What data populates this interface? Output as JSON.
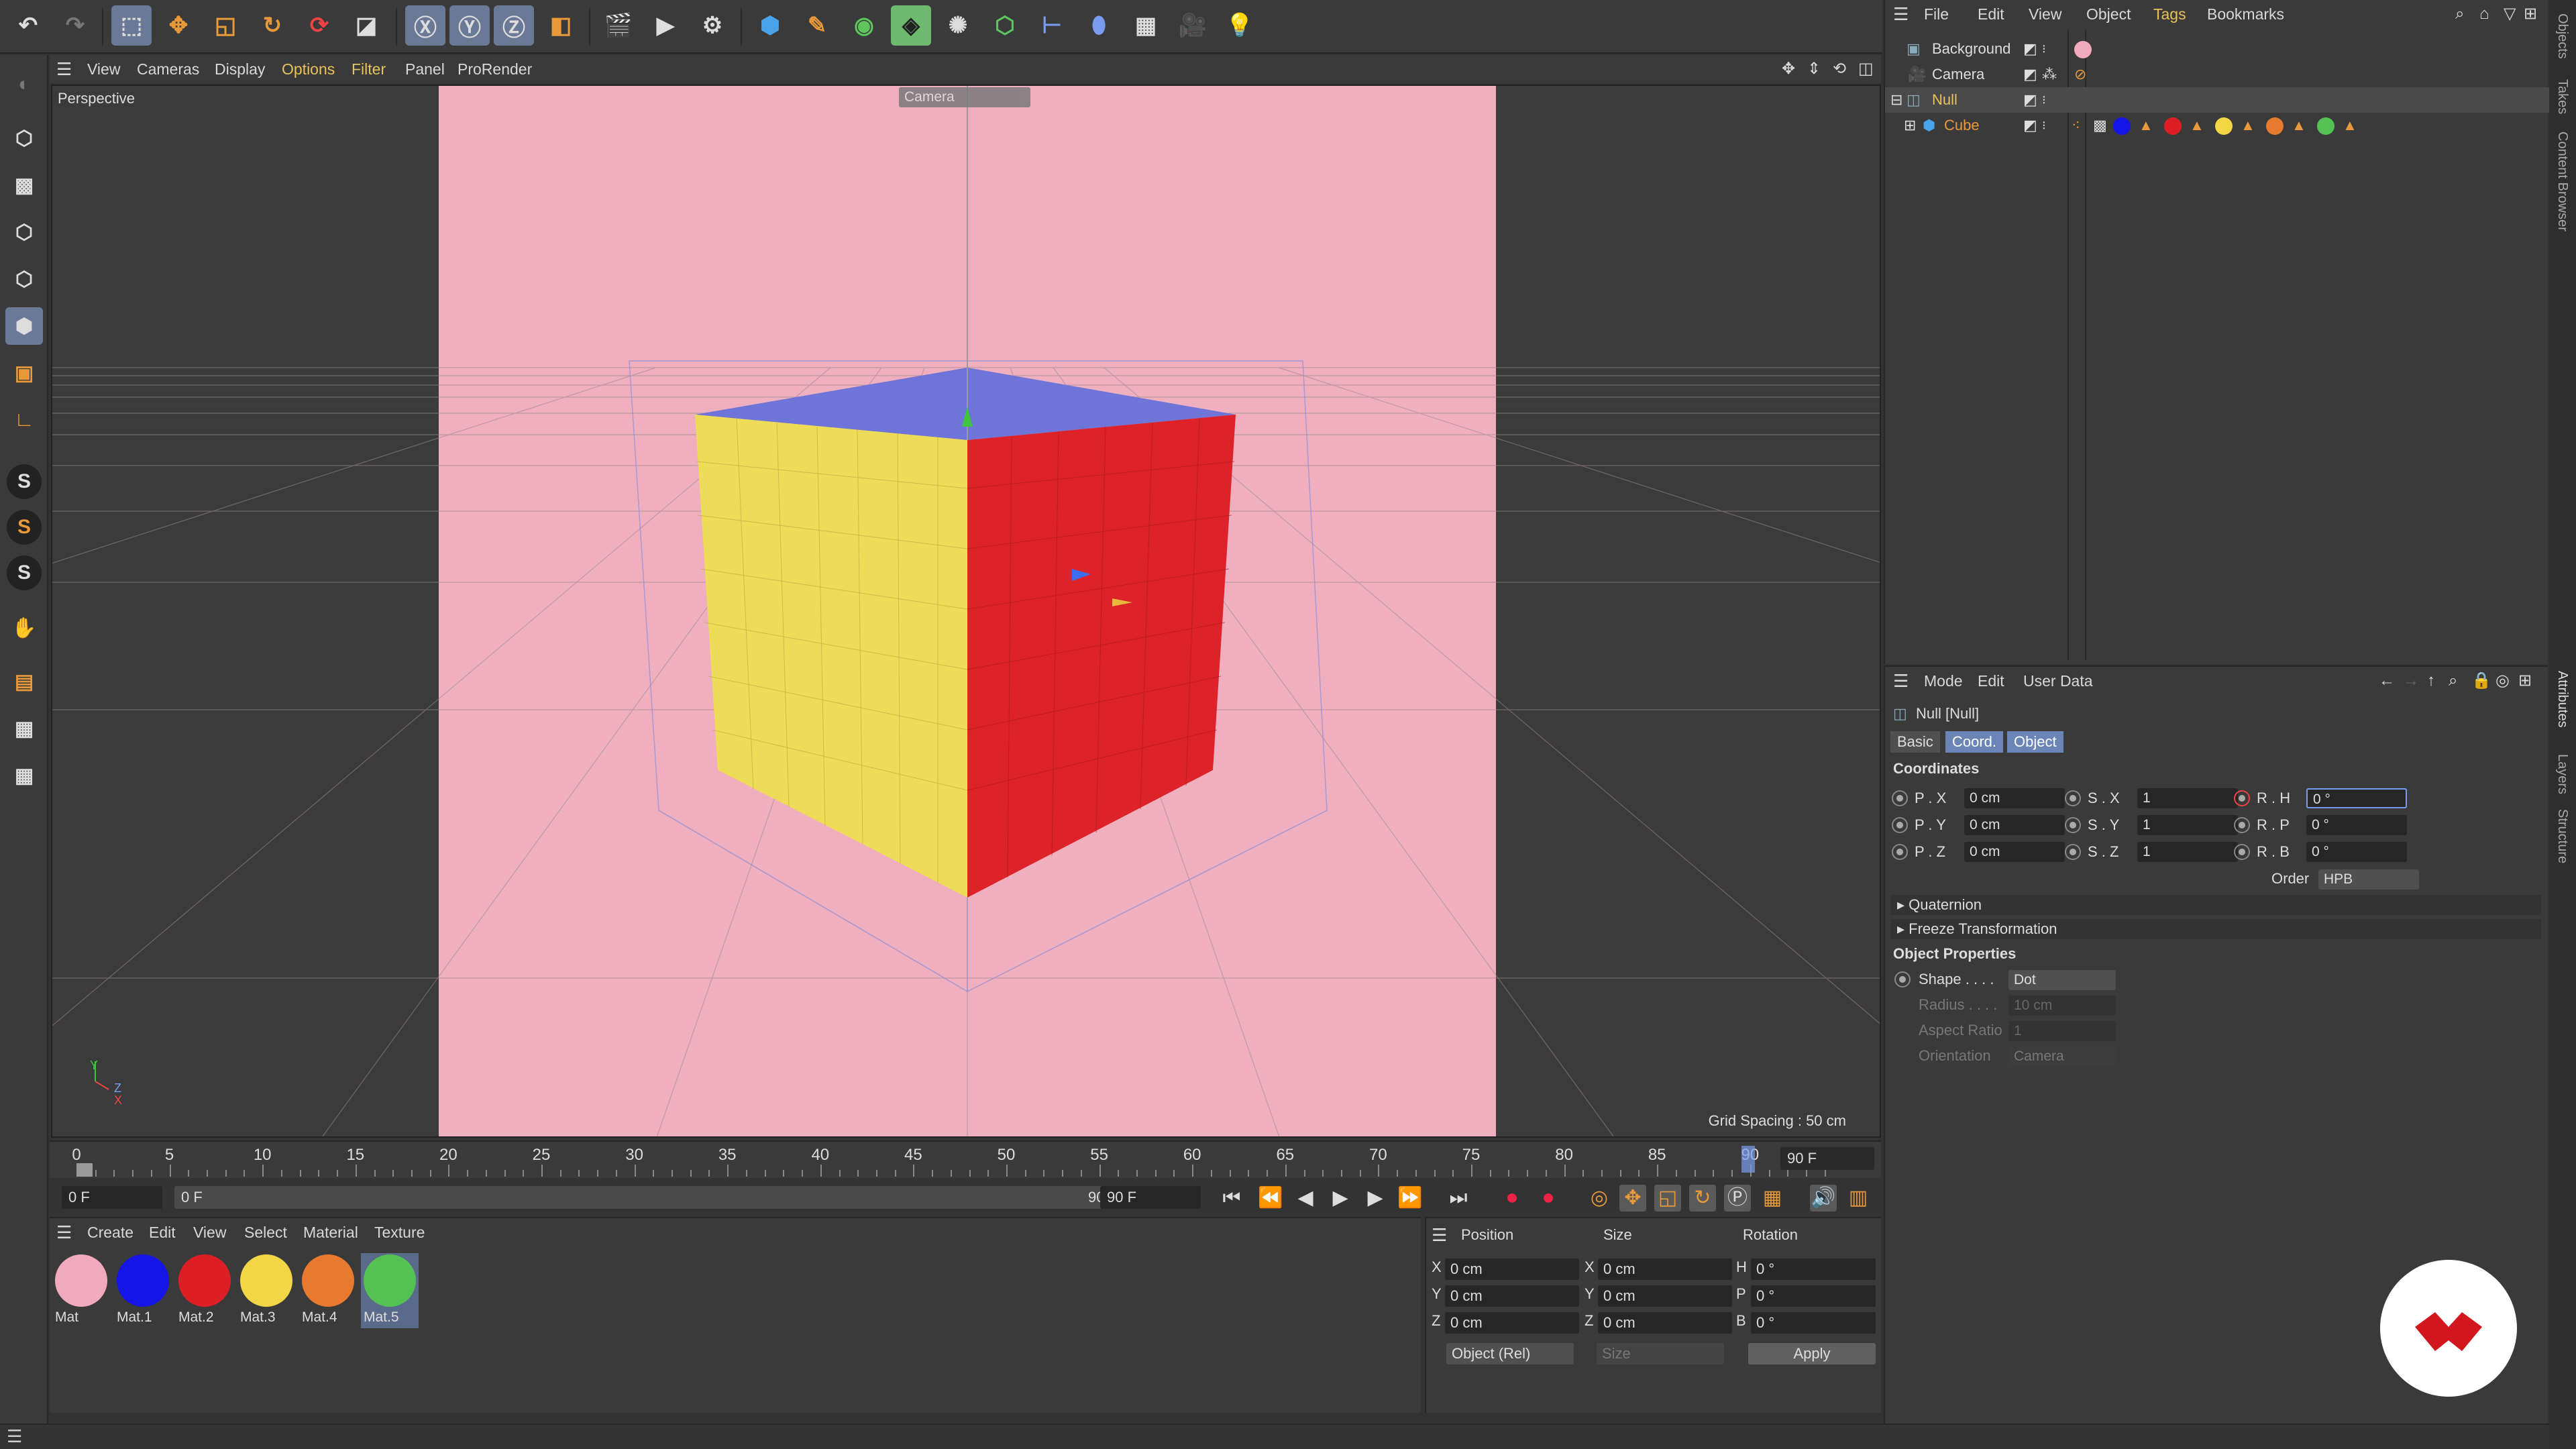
{
  "viewport_menu": [
    "View",
    "Cameras",
    "Display",
    "Options",
    "Filter",
    "Panel",
    "ProRender"
  ],
  "viewport": {
    "label": "Perspective",
    "camera_tag": "Camera",
    "grid_spacing": "Grid Spacing : 50 cm",
    "background_color": "#efafbf",
    "axis_y": "Y",
    "axis_z": "Z",
    "axis_x": "X"
  },
  "timeline": {
    "ticks": [
      "0",
      "5",
      "10",
      "15",
      "20",
      "25",
      "30",
      "35",
      "40",
      "45",
      "50",
      "55",
      "60",
      "65",
      "70",
      "75",
      "80",
      "85",
      "90"
    ],
    "end_field": "90 F",
    "start_field": "0 F",
    "current_field": "0 F",
    "range_end": "90 F",
    "max_field": "90 F"
  },
  "material_menu": [
    "Create",
    "Edit",
    "View",
    "Select",
    "Material",
    "Texture"
  ],
  "materials": [
    {
      "label": "Mat",
      "color": "#f0a9bd"
    },
    {
      "label": "Mat.1",
      "color": "#1515e8"
    },
    {
      "label": "Mat.2",
      "color": "#dd1f25"
    },
    {
      "label": "Mat.3",
      "color": "#f2d646"
    },
    {
      "label": "Mat.4",
      "color": "#e77a2e"
    },
    {
      "label": "Mat.5",
      "color": "#54c253"
    }
  ],
  "coord_panel": {
    "headers": [
      "Position",
      "Size",
      "Rotation"
    ],
    "rows": [
      {
        "axis": "X",
        "pos": "0 cm",
        "size_axis": "X",
        "size": "0 cm",
        "rot_axis": "H",
        "rot": "0 °"
      },
      {
        "axis": "Y",
        "pos": "0 cm",
        "size_axis": "Y",
        "size": "0 cm",
        "rot_axis": "P",
        "rot": "0 °"
      },
      {
        "axis": "Z",
        "pos": "0 cm",
        "size_axis": "Z",
        "size": "0 cm",
        "rot_axis": "B",
        "rot": "0 °"
      }
    ],
    "mode_select": "Object (Rel)",
    "size_select": "Size",
    "apply_label": "Apply"
  },
  "objects_menu": [
    "File",
    "Edit",
    "View",
    "Object",
    "Tags",
    "Bookmarks"
  ],
  "objects": [
    {
      "name": "Background"
    },
    {
      "name": "Camera"
    },
    {
      "name": "Null"
    },
    {
      "name": "Cube"
    }
  ],
  "cube_tag_colors": [
    "#1515e8",
    "#dd1f25",
    "#f2d646",
    "#e77a2e",
    "#54c253"
  ],
  "attributes": {
    "menu": [
      "Mode",
      "Edit",
      "User Data"
    ],
    "title": "Null [Null]",
    "tabs": [
      "Basic",
      "Coord.",
      "Object"
    ],
    "coordinates_heading": "Coordinates",
    "pos": [
      {
        "label": "P . X",
        "value": "0 cm"
      },
      {
        "label": "P . Y",
        "value": "0 cm"
      },
      {
        "label": "P . Z",
        "value": "0 cm"
      }
    ],
    "scale": [
      {
        "label": "S . X",
        "value": "1"
      },
      {
        "label": "S . Y",
        "value": "1"
      },
      {
        "label": "S . Z",
        "value": "1"
      }
    ],
    "rot": [
      {
        "label": "R . H",
        "value": "0 °"
      },
      {
        "label": "R . P",
        "value": "0 °"
      },
      {
        "label": "R . B",
        "value": "0 °"
      }
    ],
    "order_label": "Order",
    "order_value": "HPB",
    "quaternion": "Quaternion",
    "freeze": "Freeze Transformation",
    "object_properties": "Object Properties",
    "shape_label": "Shape . . . .",
    "shape_value": "Dot",
    "radius_label": "Radius . . . .",
    "radius_value": "10 cm",
    "aspect_label": "Aspect Ratio",
    "aspect_value": "1",
    "orientation_label": "Orientation",
    "orientation_value": "Camera"
  },
  "side_tabs_top": [
    "Objects",
    "Takes",
    "Content Browser"
  ],
  "side_tabs_bottom": [
    "Attributes",
    "Layers",
    "Structure"
  ]
}
